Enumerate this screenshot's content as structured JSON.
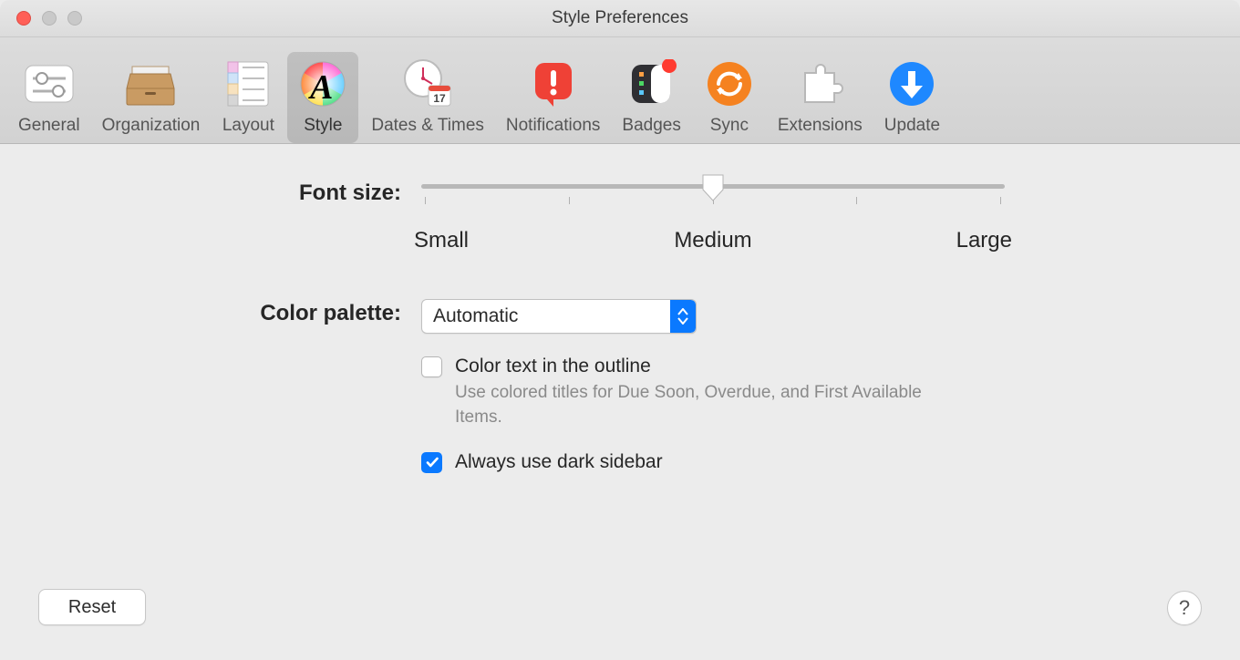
{
  "window": {
    "title": "Style Preferences"
  },
  "toolbar": {
    "items": [
      {
        "id": "general",
        "label": "General"
      },
      {
        "id": "organization",
        "label": "Organization"
      },
      {
        "id": "layout",
        "label": "Layout"
      },
      {
        "id": "style",
        "label": "Style",
        "selected": true
      },
      {
        "id": "dates",
        "label": "Dates & Times"
      },
      {
        "id": "notifications",
        "label": "Notifications"
      },
      {
        "id": "badges",
        "label": "Badges"
      },
      {
        "id": "sync",
        "label": "Sync"
      },
      {
        "id": "extensions",
        "label": "Extensions"
      },
      {
        "id": "update",
        "label": "Update"
      }
    ]
  },
  "font_size": {
    "label": "Font size:",
    "ticks": [
      "Small",
      "Medium",
      "Large"
    ],
    "total_ticks": 5,
    "value_index": 2
  },
  "color_palette": {
    "label": "Color palette:",
    "selected": "Automatic"
  },
  "color_text": {
    "label": "Color text in the outline",
    "checked": false,
    "description": "Use colored titles for Due Soon, Overdue, and First Available Items."
  },
  "dark_sidebar": {
    "label": "Always use dark sidebar",
    "checked": true
  },
  "buttons": {
    "reset": "Reset",
    "help": "?"
  },
  "colors": {
    "accent": "#0a79ff"
  }
}
